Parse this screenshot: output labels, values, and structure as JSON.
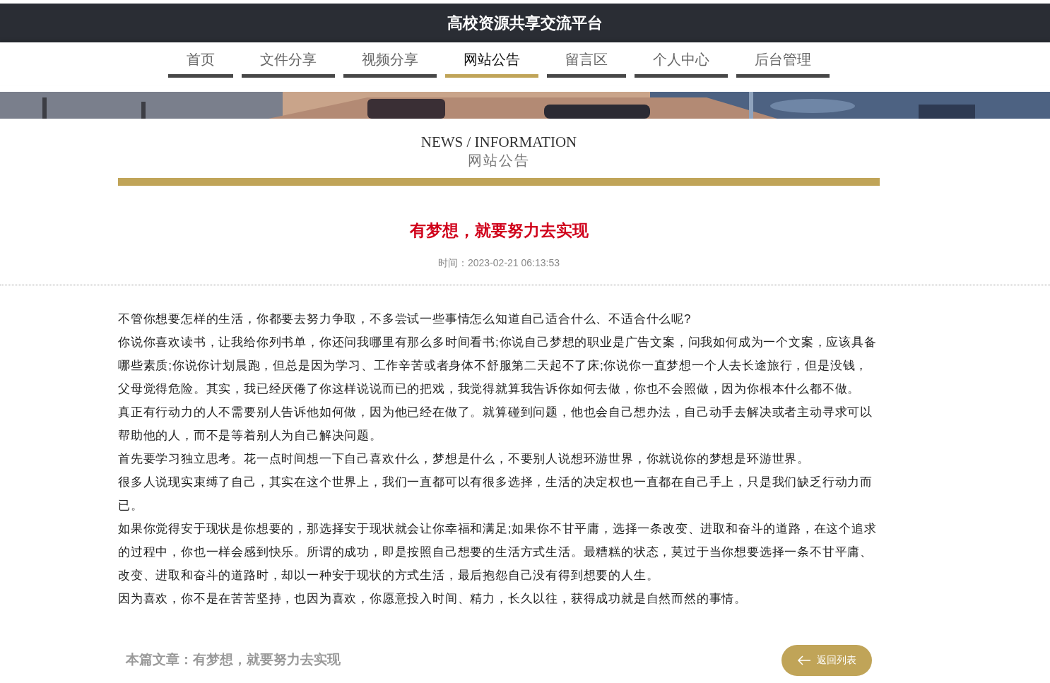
{
  "site_title": "高校资源共享交流平台",
  "nav": [
    {
      "label": "首页",
      "selected": false
    },
    {
      "label": "文件分享",
      "selected": false
    },
    {
      "label": "视频分享",
      "selected": false
    },
    {
      "label": "网站公告",
      "selected": true
    },
    {
      "label": "留言区",
      "selected": false
    },
    {
      "label": "个人中心",
      "selected": false
    },
    {
      "label": "后台管理",
      "selected": false
    }
  ],
  "section": {
    "title_en": "NEWS / INFORMATION",
    "title_cn": "网站公告"
  },
  "article": {
    "title": "有梦想，就要努力去实现",
    "time": "时间：2023-02-21 06:13:53",
    "paragraphs": [
      "不管你想要怎样的生活，你都要去努力争取，不多尝试一些事情怎么知道自己适合什么、不适合什么呢?",
      "你说你喜欢读书，让我给你列书单，你还问我哪里有那么多时间看书;你说自己梦想的职业是广告文案，问我如何成为一个文案，应该具备哪些素质;你说你计划晨跑，但总是因为学习、工作辛苦或者身体不舒服第二天起不了床;你说你一直梦想一个人去长途旅行，但是没钱，父母觉得危险。其实，我已经厌倦了你这样说说而已的把戏，我觉得就算我告诉你如何去做，你也不会照做，因为你根本什么都不做。",
      "真正有行动力的人不需要别人告诉他如何做，因为他已经在做了。就算碰到问题，他也会自己想办法，自己动手去解决或者主动寻求可以帮助他的人，而不是等着别人为自己解决问题。",
      "首先要学习独立思考。花一点时间想一下自己喜欢什么，梦想是什么，不要别人说想环游世界，你就说你的梦想是环游世界。",
      "很多人说现实束缚了自己，其实在这个世界上，我们一直都可以有很多选择，生活的决定权也一直都在自己手上，只是我们缺乏行动力而已。",
      "如果你觉得安于现状是你想要的，那选择安于现状就会让你幸福和满足;如果你不甘平庸，选择一条改变、进取和奋斗的道路，在这个追求的过程中，你也一样会感到快乐。所谓的成功，即是按照自己想要的生活方式生活。最糟糕的状态，莫过于当你想要选择一条不甘平庸、改变、进取和奋斗的道路时，却以一种安于现状的方式生活，最后抱怨自己没有得到想要的人生。",
      "因为喜欢，你不是在苦苦坚持，也因为喜欢，你愿意投入时间、精力，长久以往，获得成功就是自然而然的事情。"
    ],
    "footer_label": "本篇文章：有梦想，就要努力去实现",
    "back_button": "返回列表"
  }
}
